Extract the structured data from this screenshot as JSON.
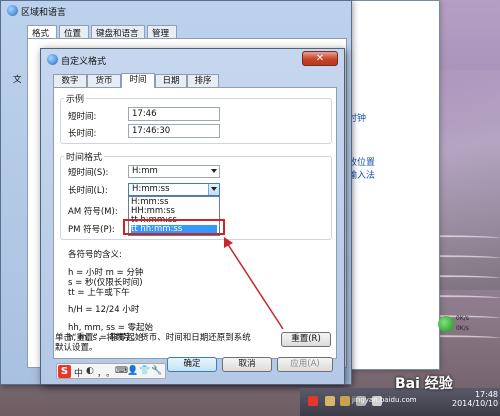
{
  "region_window": {
    "title": "区域和语言",
    "tabs": [
      "格式",
      "位置",
      "键盘和语言",
      "管理"
    ],
    "side_fragment": "文"
  },
  "background_window": {
    "links": [
      "的时钟",
      "更改位置",
      "他输入法"
    ]
  },
  "dialog": {
    "title": "自定义格式",
    "close_glyph": "✕",
    "tabs": [
      "数字",
      "货币",
      "时间",
      "日期",
      "排序"
    ],
    "active_tab": "时间",
    "example": {
      "group_label": "示例",
      "short_time_label": "短时间:",
      "short_time_value": "17:46",
      "long_time_label": "长时间:",
      "long_time_value": "17:46:30"
    },
    "formats": {
      "group_label": "时间格式",
      "short_time_label": "短时间(S):",
      "short_time_value": "H:mm",
      "long_time_label": "长时间(L):",
      "long_time_value": "H:mm:ss",
      "am_label": "AM 符号(M):",
      "pm_label": "PM 符号(P):",
      "dropdown_options": [
        "H:mm:ss",
        "HH:mm:ss",
        "tt h:mm:ss",
        "tt hh:mm:ss"
      ],
      "highlighted_option": "tt hh:mm:ss"
    },
    "notes": {
      "heading": "各符号的含义:",
      "lines": [
        "h = 小时    m = 分钟",
        "s = 秒(仅限长时间)",
        "tt = 上午或下午",
        "h/H = 12/24 小时",
        "hh, mm, ss = 零起始",
        "h, m, s = 非零起始"
      ]
    },
    "reset_text_line1": "单击“重置”，将数字、货币、时间和日期还原到系统",
    "reset_text_line2": "默认设置。",
    "reset_button": "重置(R)",
    "ok_button": "确定",
    "cancel_button": "取消",
    "apply_button": "应用(A)"
  },
  "ime": {
    "logo": "S",
    "glyphs": [
      "中",
      "◐",
      "，",
      "。",
      "⌨",
      "👤",
      "👕",
      "🔧"
    ]
  },
  "speed_meter": {
    "up": "0K/s",
    "down": "0K/s"
  },
  "tray": {
    "time": "17:48",
    "date": "2014/10/10"
  },
  "watermark": {
    "text": "Bai 经验",
    "url": "jingyan.baidu.com"
  },
  "colors": {
    "highlight": "#3399ff",
    "annotation_red": "#c8262a",
    "close_red": "#c6432a"
  }
}
